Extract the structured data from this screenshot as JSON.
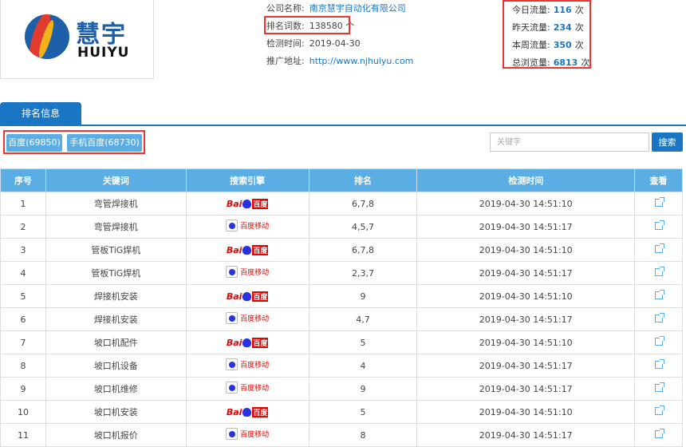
{
  "logo": {
    "cn": "慧宇",
    "en": "HUIYU"
  },
  "company": {
    "name_label": "公司名称:",
    "name_value": "南京慧宇自动化有限公司",
    "words_label": "排名词数:",
    "words_value": "138580 个",
    "date_label": "检测时间:",
    "date_value": "2019-04-30",
    "url_label": "推广地址:",
    "url_value": "http://www.njhuiyu.com"
  },
  "stats": [
    {
      "label": "今日流量:",
      "value": "116",
      "unit": "次"
    },
    {
      "label": "昨天流量:",
      "value": "234",
      "unit": "次"
    },
    {
      "label": "本周流量:",
      "value": "350",
      "unit": "次"
    },
    {
      "label": "总浏览量:",
      "value": "6813",
      "unit": "次"
    }
  ],
  "tab": {
    "label": "排名信息"
  },
  "filters": [
    {
      "label": "百度(69850)"
    },
    {
      "label": "手机百度(68730)"
    }
  ],
  "search": {
    "placeholder": "关键字",
    "button": "搜索"
  },
  "table": {
    "headers": [
      "序号",
      "关键词",
      "搜索引擎",
      "排名",
      "检测时间",
      "查看"
    ],
    "rows": [
      {
        "seq": "1",
        "keyword": "弯管焊接机",
        "engine": "baidu",
        "rank": "6,7,8",
        "time": "2019-04-30 14:51:10"
      },
      {
        "seq": "2",
        "keyword": "弯管焊接机",
        "engine": "baidu-mobile",
        "rank": "4,5,7",
        "time": "2019-04-30 14:51:17"
      },
      {
        "seq": "3",
        "keyword": "管板TiG焊机",
        "engine": "baidu",
        "rank": "6,7,8",
        "time": "2019-04-30 14:51:10"
      },
      {
        "seq": "4",
        "keyword": "管板TiG焊机",
        "engine": "baidu-mobile",
        "rank": "2,3,7",
        "time": "2019-04-30 14:51:17"
      },
      {
        "seq": "5",
        "keyword": "焊接机安装",
        "engine": "baidu",
        "rank": "9",
        "time": "2019-04-30 14:51:10"
      },
      {
        "seq": "6",
        "keyword": "焊接机安装",
        "engine": "baidu-mobile",
        "rank": "4,7",
        "time": "2019-04-30 14:51:17"
      },
      {
        "seq": "7",
        "keyword": "坡口机配件",
        "engine": "baidu",
        "rank": "5",
        "time": "2019-04-30 14:51:10"
      },
      {
        "seq": "8",
        "keyword": "坡口机设备",
        "engine": "baidu-mobile",
        "rank": "4",
        "time": "2019-04-30 14:51:17"
      },
      {
        "seq": "9",
        "keyword": "坡口机维修",
        "engine": "baidu-mobile",
        "rank": "9",
        "time": "2019-04-30 14:51:17"
      },
      {
        "seq": "10",
        "keyword": "坡口机安装",
        "engine": "baidu",
        "rank": "5",
        "time": "2019-04-30 14:51:10"
      },
      {
        "seq": "11",
        "keyword": "坡口机报价",
        "engine": "baidu-mobile",
        "rank": "8",
        "time": "2019-04-30 14:51:17"
      }
    ]
  },
  "engine_logos": {
    "baidu": {
      "bai": "Bai",
      "du": "百度"
    },
    "baidu-mobile": {
      "text": "百度移动"
    }
  },
  "colors": {
    "accent": "#1a76c5",
    "header_bg": "#5aaee3",
    "highlight": "#ee3333"
  }
}
